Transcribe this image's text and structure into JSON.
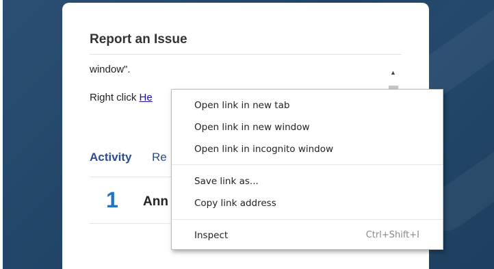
{
  "card": {
    "title": "Report an Issue",
    "body_line1": "window\".",
    "body_line2_prefix": "Right click ",
    "body_line2_link": "He"
  },
  "tabs": {
    "activity": "Activity",
    "other_partial": "Re"
  },
  "activity": {
    "number": "1",
    "name_partial": "Ann"
  },
  "context_menu": {
    "items": [
      {
        "label": "Open link in new tab"
      },
      {
        "label": "Open link in new window"
      },
      {
        "label": "Open link in incognito window"
      },
      {
        "label": "Save link as..."
      },
      {
        "label": "Copy link address"
      },
      {
        "label": "Inspect",
        "shortcut": "Ctrl+Shift+I"
      }
    ]
  },
  "colors": {
    "backdrop": "#23486b",
    "link": "#1a0dab",
    "tab_text": "#2b4d8a",
    "activity_number": "#1f75c4"
  },
  "icons": {
    "scroll_up": "triangle-up-icon"
  }
}
